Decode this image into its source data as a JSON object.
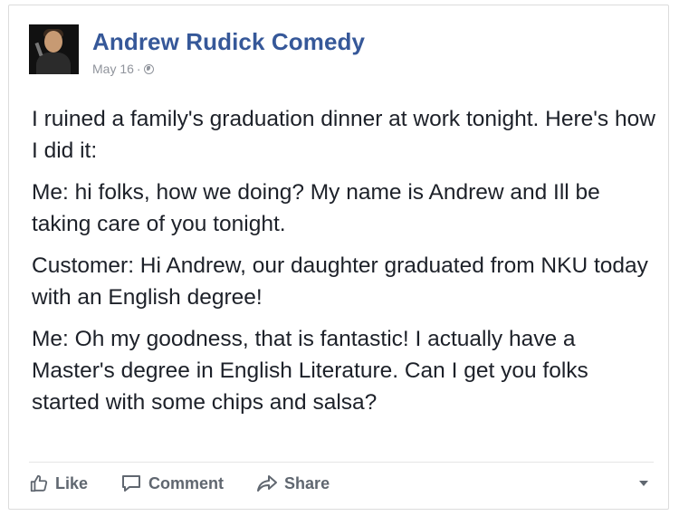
{
  "post": {
    "author": "Andrew Rudick Comedy",
    "timestamp": "May 16",
    "separator": "·",
    "privacy_icon": "globe-icon",
    "paragraphs": [
      "I ruined a family's graduation dinner at work tonight. Here's how I did it:",
      "Me: hi folks, how we doing? My name is Andrew and Ill be taking care of you tonight.",
      "Customer: Hi Andrew, our daughter graduated from NKU today with an English degree!",
      "Me: Oh my goodness, that is fantastic! I actually have a Master's degree in English Literature. Can I get you folks started with some chips and salsa?"
    ]
  },
  "actions": {
    "like_label": "Like",
    "comment_label": "Comment",
    "share_label": "Share"
  },
  "colors": {
    "author_link": "#365899",
    "body_text": "#1d2129",
    "meta_text": "#90949c",
    "action_text": "#606770"
  }
}
